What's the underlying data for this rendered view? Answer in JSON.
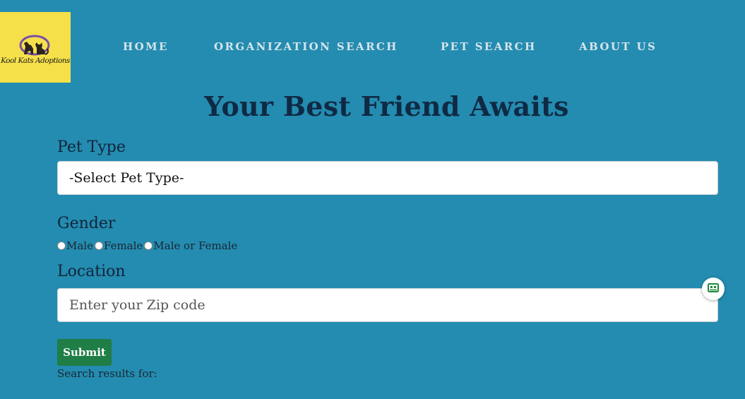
{
  "logo": {
    "text": "Kool Kats Adoptions",
    "bg_color": "#f6e04a",
    "ring_color": "#7b4fa8"
  },
  "nav": {
    "items": [
      {
        "label": "HOME"
      },
      {
        "label": "ORGANIZATION SEARCH"
      },
      {
        "label": "PET SEARCH"
      },
      {
        "label": "ABOUT US"
      }
    ]
  },
  "hero": {
    "title": "Your Best Friend Awaits"
  },
  "form": {
    "pet_type": {
      "label": "Pet Type",
      "selected": "-Select Pet Type-"
    },
    "gender": {
      "label": "Gender",
      "options": [
        {
          "label": "Male"
        },
        {
          "label": "Female"
        },
        {
          "label": "Male or Female"
        }
      ]
    },
    "location": {
      "label": "Location",
      "placeholder": "Enter your Zip code",
      "value": ""
    },
    "submit_label": "Submit",
    "results_label": "Search results for:"
  },
  "widget": {
    "icon": "robot-chat-icon"
  },
  "colors": {
    "page_bg": "#248cb0",
    "title": "#0f2a44",
    "nav_text": "#d6e4ec",
    "submit_bg": "#1e7e46"
  }
}
